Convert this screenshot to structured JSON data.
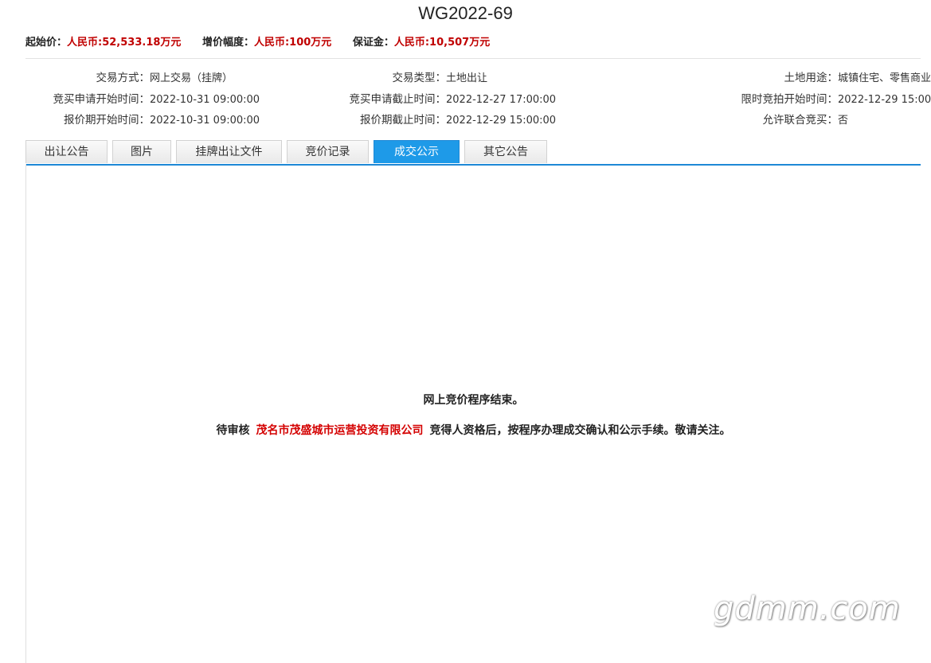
{
  "title": "WG2022-69",
  "price_bar": {
    "start_price_label": "起始价：",
    "start_price_value": "人民币:52,533.18万元",
    "increment_label": "增价幅度：",
    "increment_value": "人民币:100万元",
    "deposit_label": "保证金：",
    "deposit_value": "人民币:10,507万元"
  },
  "info": {
    "row1": {
      "trade_method_label": "交易方式：",
      "trade_method_value": "网上交易（挂牌）",
      "trade_type_label": "交易类型：",
      "trade_type_value": "土地出让",
      "land_use_label": "土地用途：",
      "land_use_value": "城镇住宅、零售商业"
    },
    "row2": {
      "apply_start_label": "竞买申请开始时间：",
      "apply_start_value": "2022-10-31 09:00:00",
      "apply_end_label": "竞买申请截止时间：",
      "apply_end_value": "2022-12-27 17:00:00",
      "auction_start_label": "限时竞拍开始时间：",
      "auction_start_value": "2022-12-29 15:00:00"
    },
    "row3": {
      "quote_start_label": "报价期开始时间：",
      "quote_start_value": "2022-10-31 09:00:00",
      "quote_end_label": "报价期截止时间：",
      "quote_end_value": "2022-12-29 15:00:00",
      "joint_label": "允许联合竞买：",
      "joint_value": "否"
    }
  },
  "tabs": [
    {
      "label": "出让公告"
    },
    {
      "label": "图片"
    },
    {
      "label": "挂牌出让文件"
    },
    {
      "label": "竞价记录"
    },
    {
      "label": "成交公示",
      "active": true
    },
    {
      "label": "其它公告"
    }
  ],
  "result": {
    "line1": "网上竞价程序结束。",
    "line2_prefix": "待审核",
    "company": "茂名市茂盛城市运营投资有限公司",
    "line2_suffix": "竞得人资格后，按程序办理成交确认和公示手续。敬请关注。"
  },
  "watermark": "gdmm.com",
  "colors": {
    "accent_blue": "#1e9ae8",
    "value_red": "#c00000",
    "company_red": "#d40000"
  }
}
